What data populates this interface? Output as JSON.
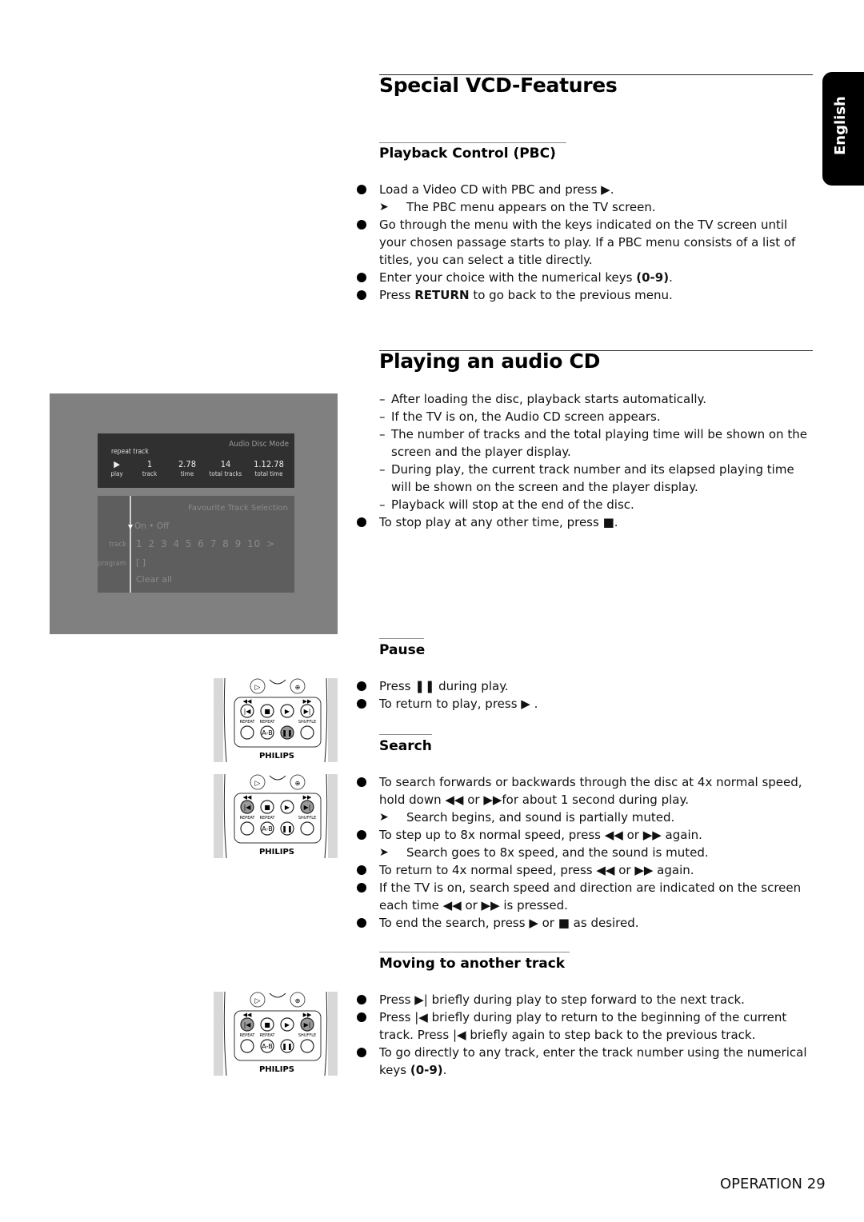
{
  "language_tab": "English",
  "sections": {
    "vcd": {
      "title": "Special VCD-Features",
      "pbc": {
        "title": "Playback Control (PBC)",
        "items": [
          {
            "type": "bullet",
            "text": "Load a Video CD with PBC and press ▶."
          },
          {
            "type": "result",
            "text": "The PBC menu appears on the TV screen."
          },
          {
            "type": "bullet",
            "text": "Go through the menu with the keys indicated on the TV screen until your chosen passage starts to play. If a PBC menu consists of a list of titles, you can select a title directly."
          },
          {
            "type": "bullet",
            "pre": "Enter your choice with the numerical keys ",
            "bold": "(0-9)",
            "post": "."
          },
          {
            "type": "bullet",
            "pre": "Press ",
            "bold": "RETURN",
            "post": " to go back to the previous menu."
          }
        ]
      }
    },
    "audio_cd": {
      "title": "Playing an audio CD",
      "items": [
        {
          "type": "dash",
          "text": "After loading the disc, playback starts automatically."
        },
        {
          "type": "dash",
          "text": "If the TV is on, the Audio CD screen appears."
        },
        {
          "type": "dash",
          "text": "The number of tracks and the total playing time will be shown on the screen and the player display."
        },
        {
          "type": "dash",
          "text": "During play, the current track number and its elapsed playing time will be shown on the screen and the player display."
        },
        {
          "type": "dash",
          "text": "Playback will stop at the end of the disc."
        },
        {
          "type": "bullet",
          "text": "To stop play at any other time, press ■."
        }
      ],
      "tv_screen": {
        "mode": "Audio Disc Mode",
        "repeat": "repeat track",
        "columns": [
          {
            "value": "▶",
            "label": "play"
          },
          {
            "value": "1",
            "label": "track"
          },
          {
            "value": "2.78",
            "label": "time"
          },
          {
            "value": "14",
            "label": "total tracks"
          },
          {
            "value": "1.12.78",
            "label": "total time"
          }
        ],
        "fav_title": "Favourite Track Selection",
        "on_off": "On • Off",
        "track_label": "track",
        "track_numbers": "1 2 3 4 5  6 7 8  9  10 >",
        "program_label": "program",
        "program_value": "[ ]",
        "clear_all": "Clear all"
      }
    },
    "pause": {
      "title": "Pause",
      "items": [
        {
          "type": "bullet",
          "text": "Press ❚❚ during play."
        },
        {
          "type": "bullet",
          "text": "To return to play, press ▶ ."
        }
      ]
    },
    "search": {
      "title": "Search",
      "items": [
        {
          "type": "bullet",
          "text": "To search forwards or backwards through the disc at 4x normal speed, hold down ◀◀  or ▶▶for about 1 second during play."
        },
        {
          "type": "result",
          "text": "Search begins, and sound is partially muted."
        },
        {
          "type": "bullet",
          "text": "To step up to 8x normal speed, press ◀◀  or ▶▶ again."
        },
        {
          "type": "result",
          "text": "Search goes to 8x speed, and the sound is muted."
        },
        {
          "type": "bullet",
          "text": "To return to 4x normal speed, press ◀◀  or ▶▶ again."
        },
        {
          "type": "bullet",
          "text": "If the TV is on, search speed and direction are indicated on the screen each time ◀◀  or ▶▶ is pressed."
        },
        {
          "type": "bullet",
          "text": "To end the search, press ▶ or ■ as desired."
        }
      ]
    },
    "moving": {
      "title": "Moving to another track",
      "items": [
        {
          "type": "bullet",
          "text": "Press ▶| briefly during play to step forward to the next track."
        },
        {
          "type": "bullet",
          "text": "Press |◀ briefly during play to return to the beginning of the current track. Press |◀ briefly again to step back to the previous track."
        },
        {
          "type": "bullet",
          "pre": "To go directly to any track, enter the track number using the numerical keys ",
          "bold": "(0-9)",
          "post": "."
        }
      ]
    }
  },
  "remote": {
    "brand": "PHILIPS",
    "labels": [
      "REPEAT",
      "REPEAT",
      "SHUFFLE",
      "A-B"
    ]
  },
  "footer": {
    "page_label": "OPERATION 29"
  }
}
